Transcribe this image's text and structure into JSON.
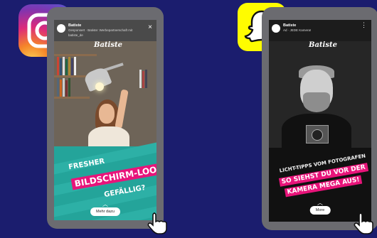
{
  "colors": {
    "background": "#1b1d6e",
    "magenta": "#e8147a",
    "teal": "#24a49a",
    "snap_yellow": "#fffc00"
  },
  "icons": {
    "left_app": "instagram-icon",
    "right_app": "snapchat-icon",
    "pointer": "hand-pointer-icon"
  },
  "left_story": {
    "account": "Batiste",
    "sponsored_line": "Gesponsert · Batiste: Werbepartnerschaft mit",
    "handle": "batiste_de",
    "brand": "Batiste",
    "headline_1": "FRESHER",
    "headline_2": "BILDSCHIRM-LOOK",
    "headline_3": "GEFÄLLIG?",
    "cta": "Mehr dazu"
  },
  "right_story": {
    "account": "Batiste",
    "sponsored_line": "Ad · JEDE Kamera!",
    "brand": "Batiste",
    "headline_1": "LICHT-TIPPS VOM FOTOGRAFEN",
    "headline_2": "SO SIEHST DU VOR DER",
    "headline_3": "KAMERA MEGA AUS!",
    "cta": "More"
  }
}
